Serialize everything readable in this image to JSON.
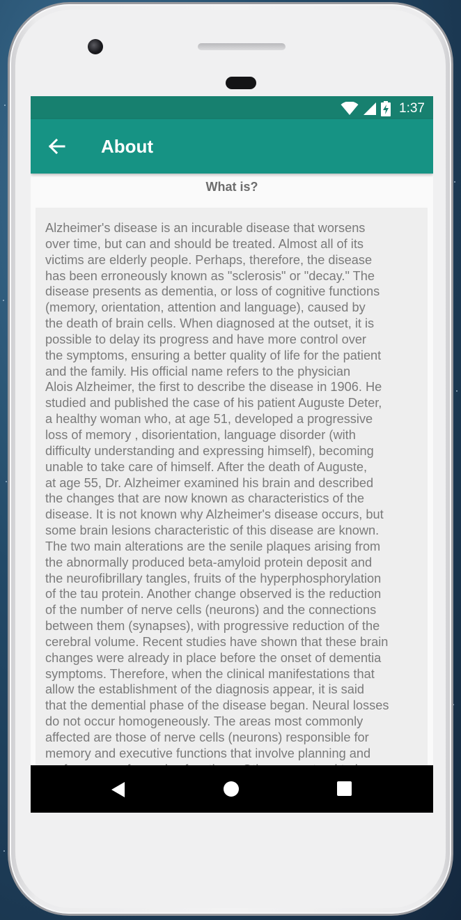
{
  "status_bar": {
    "time": "1:37",
    "icons": [
      "wifi-icon",
      "cell-signal-icon",
      "battery-charging-icon"
    ]
  },
  "app_bar": {
    "back_icon": "arrow-left-icon",
    "title": "About"
  },
  "section": {
    "heading": "What is?"
  },
  "content": {
    "text": "Alzheimer's disease is an incurable disease that worsens\nover time, but can and should be treated. Almost all of its\nvictims are elderly people. Perhaps, therefore, the disease\nhas been erroneously known as \"sclerosis\" or \"decay.\" The\ndisease presents as dementia, or loss of cognitive functions\n(memory, orientation, attention and language), caused by\nthe death of brain cells. When diagnosed at the outset, it is\npossible to delay its progress and have more control over\nthe symptoms, ensuring a better quality of life for the patient\nand the family. His official name refers to the physician\nAlois Alzheimer, the first to describe the disease in 1906. He\nstudied and published the case of his patient Auguste Deter,\na healthy woman who, at age 51, developed a progressive\nloss of memory , disorientation, language disorder (with\ndifficulty understanding and expressing himself), becoming\nunable to take care of himself. After the death of Auguste,\nat age 55, Dr. Alzheimer examined his brain and described\nthe changes that are now known as characteristics of the\ndisease. It is not known why Alzheimer's disease occurs, but\nsome brain lesions characteristic of this disease are known.\nThe two main alterations are the senile plaques arising from\nthe abnormally produced beta-amyloid protein deposit and\nthe neurofibrillary tangles, fruits of the hyperphosphorylation\nof the tau protein. Another change observed is the reduction\nof the number of nerve cells (neurons) and the connections\nbetween them (synapses), with progressive reduction of the\ncerebral volume. Recent studies have shown that these brain\nchanges were already in place before the onset of dementia\nsymptoms. Therefore, when the clinical manifestations that\nallow the establishment of the diagnosis appear, it is said\nthat the demential phase of the disease began. Neural losses\ndo not occur homogeneously. The areas most commonly\naffected are those of nerve cells (neurons) responsible for\nmemory and executive functions that involve planning and\nperformance of complex functions. Other areas tend to be"
  },
  "nav_bar": {
    "icons": [
      "back-triangle-icon",
      "home-circle-icon",
      "recents-square-icon"
    ]
  },
  "colors": {
    "status_bar": "#17806f",
    "app_bar": "#169384",
    "text": "#7a7a7a",
    "content_bg": "#eeeeee"
  }
}
